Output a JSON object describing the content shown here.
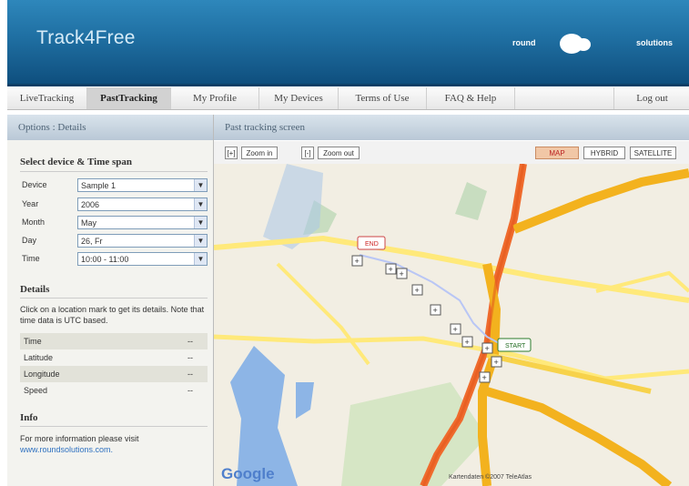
{
  "header": {
    "title": "Track4Free",
    "logo_left": "round",
    "logo_right": "solutions"
  },
  "nav": {
    "tabs": [
      {
        "label": "LiveTracking"
      },
      {
        "label": "PastTracking"
      },
      {
        "label": "My Profile"
      },
      {
        "label": "My Devices"
      },
      {
        "label": "Terms of Use"
      },
      {
        "label": "FAQ & Help"
      },
      {
        "label": "Log out"
      }
    ]
  },
  "left": {
    "header": "Options : Details",
    "select_title": "Select device & Time span",
    "fields": {
      "device": {
        "label": "Device",
        "value": "Sample 1"
      },
      "year": {
        "label": "Year",
        "value": "2006"
      },
      "month": {
        "label": "Month",
        "value": "May"
      },
      "day": {
        "label": "Day",
        "value": "26, Fr"
      },
      "time": {
        "label": "Time",
        "value": "10:00 - 11:00"
      }
    },
    "details_title": "Details",
    "details_text": "Click on a location mark to get its details. Note that time data is UTC based.",
    "details": [
      {
        "key": "Time",
        "value": "--"
      },
      {
        "key": "Latitude",
        "value": "--"
      },
      {
        "key": "Longitude",
        "value": "--"
      },
      {
        "key": "Speed",
        "value": "--"
      }
    ],
    "info_title": "Info",
    "info_text": "For more information please visit",
    "info_link": "www.roundsolutions.com."
  },
  "right": {
    "header": "Past tracking screen"
  },
  "map": {
    "zoom_in_icon": "[+]",
    "zoom_in_label": "Zoom in",
    "zoom_out_icon": "[-]",
    "zoom_out_label": "Zoom out",
    "modes": [
      "MAP",
      "HYBRID",
      "SATELLITE"
    ],
    "markers": {
      "start": "START",
      "end": "END"
    },
    "credit_logo": "Google",
    "attribution": "Kartendaten ©2007 TeleAtlas"
  }
}
